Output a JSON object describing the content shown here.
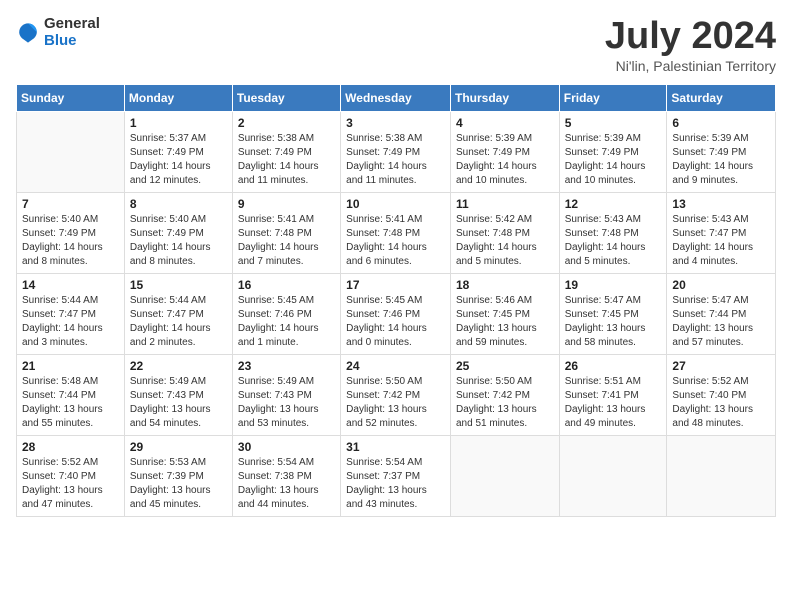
{
  "logo": {
    "general": "General",
    "blue": "Blue"
  },
  "title": "July 2024",
  "subtitle": "Ni'lin, Palestinian Territory",
  "days_header": [
    "Sunday",
    "Monday",
    "Tuesday",
    "Wednesday",
    "Thursday",
    "Friday",
    "Saturday"
  ],
  "weeks": [
    [
      {
        "day": "",
        "info": ""
      },
      {
        "day": "1",
        "info": "Sunrise: 5:37 AM\nSunset: 7:49 PM\nDaylight: 14 hours\nand 12 minutes."
      },
      {
        "day": "2",
        "info": "Sunrise: 5:38 AM\nSunset: 7:49 PM\nDaylight: 14 hours\nand 11 minutes."
      },
      {
        "day": "3",
        "info": "Sunrise: 5:38 AM\nSunset: 7:49 PM\nDaylight: 14 hours\nand 11 minutes."
      },
      {
        "day": "4",
        "info": "Sunrise: 5:39 AM\nSunset: 7:49 PM\nDaylight: 14 hours\nand 10 minutes."
      },
      {
        "day": "5",
        "info": "Sunrise: 5:39 AM\nSunset: 7:49 PM\nDaylight: 14 hours\nand 10 minutes."
      },
      {
        "day": "6",
        "info": "Sunrise: 5:39 AM\nSunset: 7:49 PM\nDaylight: 14 hours\nand 9 minutes."
      }
    ],
    [
      {
        "day": "7",
        "info": "Sunrise: 5:40 AM\nSunset: 7:49 PM\nDaylight: 14 hours\nand 8 minutes."
      },
      {
        "day": "8",
        "info": "Sunrise: 5:40 AM\nSunset: 7:49 PM\nDaylight: 14 hours\nand 8 minutes."
      },
      {
        "day": "9",
        "info": "Sunrise: 5:41 AM\nSunset: 7:48 PM\nDaylight: 14 hours\nand 7 minutes."
      },
      {
        "day": "10",
        "info": "Sunrise: 5:41 AM\nSunset: 7:48 PM\nDaylight: 14 hours\nand 6 minutes."
      },
      {
        "day": "11",
        "info": "Sunrise: 5:42 AM\nSunset: 7:48 PM\nDaylight: 14 hours\nand 5 minutes."
      },
      {
        "day": "12",
        "info": "Sunrise: 5:43 AM\nSunset: 7:48 PM\nDaylight: 14 hours\nand 5 minutes."
      },
      {
        "day": "13",
        "info": "Sunrise: 5:43 AM\nSunset: 7:47 PM\nDaylight: 14 hours\nand 4 minutes."
      }
    ],
    [
      {
        "day": "14",
        "info": "Sunrise: 5:44 AM\nSunset: 7:47 PM\nDaylight: 14 hours\nand 3 minutes."
      },
      {
        "day": "15",
        "info": "Sunrise: 5:44 AM\nSunset: 7:47 PM\nDaylight: 14 hours\nand 2 minutes."
      },
      {
        "day": "16",
        "info": "Sunrise: 5:45 AM\nSunset: 7:46 PM\nDaylight: 14 hours\nand 1 minute."
      },
      {
        "day": "17",
        "info": "Sunrise: 5:45 AM\nSunset: 7:46 PM\nDaylight: 14 hours\nand 0 minutes."
      },
      {
        "day": "18",
        "info": "Sunrise: 5:46 AM\nSunset: 7:45 PM\nDaylight: 13 hours\nand 59 minutes."
      },
      {
        "day": "19",
        "info": "Sunrise: 5:47 AM\nSunset: 7:45 PM\nDaylight: 13 hours\nand 58 minutes."
      },
      {
        "day": "20",
        "info": "Sunrise: 5:47 AM\nSunset: 7:44 PM\nDaylight: 13 hours\nand 57 minutes."
      }
    ],
    [
      {
        "day": "21",
        "info": "Sunrise: 5:48 AM\nSunset: 7:44 PM\nDaylight: 13 hours\nand 55 minutes."
      },
      {
        "day": "22",
        "info": "Sunrise: 5:49 AM\nSunset: 7:43 PM\nDaylight: 13 hours\nand 54 minutes."
      },
      {
        "day": "23",
        "info": "Sunrise: 5:49 AM\nSunset: 7:43 PM\nDaylight: 13 hours\nand 53 minutes."
      },
      {
        "day": "24",
        "info": "Sunrise: 5:50 AM\nSunset: 7:42 PM\nDaylight: 13 hours\nand 52 minutes."
      },
      {
        "day": "25",
        "info": "Sunrise: 5:50 AM\nSunset: 7:42 PM\nDaylight: 13 hours\nand 51 minutes."
      },
      {
        "day": "26",
        "info": "Sunrise: 5:51 AM\nSunset: 7:41 PM\nDaylight: 13 hours\nand 49 minutes."
      },
      {
        "day": "27",
        "info": "Sunrise: 5:52 AM\nSunset: 7:40 PM\nDaylight: 13 hours\nand 48 minutes."
      }
    ],
    [
      {
        "day": "28",
        "info": "Sunrise: 5:52 AM\nSunset: 7:40 PM\nDaylight: 13 hours\nand 47 minutes."
      },
      {
        "day": "29",
        "info": "Sunrise: 5:53 AM\nSunset: 7:39 PM\nDaylight: 13 hours\nand 45 minutes."
      },
      {
        "day": "30",
        "info": "Sunrise: 5:54 AM\nSunset: 7:38 PM\nDaylight: 13 hours\nand 44 minutes."
      },
      {
        "day": "31",
        "info": "Sunrise: 5:54 AM\nSunset: 7:37 PM\nDaylight: 13 hours\nand 43 minutes."
      },
      {
        "day": "",
        "info": ""
      },
      {
        "day": "",
        "info": ""
      },
      {
        "day": "",
        "info": ""
      }
    ]
  ]
}
